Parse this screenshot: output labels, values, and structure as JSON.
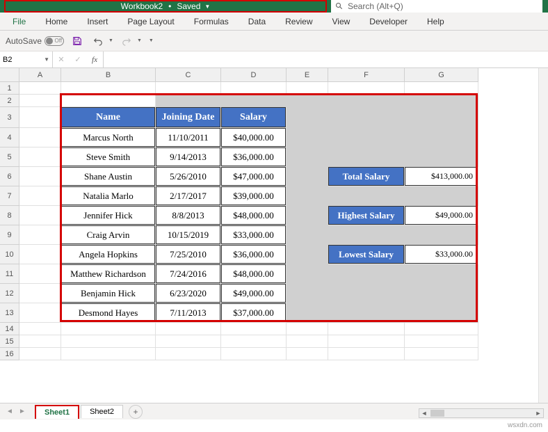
{
  "titlebar": {
    "workbook": "Workbook2",
    "status": "Saved"
  },
  "search": {
    "placeholder": "Search (Alt+Q)"
  },
  "ribbon": {
    "tabs": [
      "File",
      "Home",
      "Insert",
      "Page Layout",
      "Formulas",
      "Data",
      "Review",
      "View",
      "Developer",
      "Help"
    ]
  },
  "qat": {
    "autosave_label": "AutoSave",
    "autosave_off": "Off"
  },
  "namebox": {
    "value": "B2"
  },
  "columns": [
    {
      "letter": "A",
      "width": 60
    },
    {
      "letter": "B",
      "width": 136
    },
    {
      "letter": "C",
      "width": 94
    },
    {
      "letter": "D",
      "width": 94
    },
    {
      "letter": "E",
      "width": 60
    },
    {
      "letter": "F",
      "width": 110
    },
    {
      "letter": "G",
      "width": 106
    }
  ],
  "rows": [
    {
      "n": 1,
      "h": 18
    },
    {
      "n": 2,
      "h": 18
    },
    {
      "n": 3,
      "h": 30
    },
    {
      "n": 4,
      "h": 28
    },
    {
      "n": 5,
      "h": 28
    },
    {
      "n": 6,
      "h": 28
    },
    {
      "n": 7,
      "h": 28
    },
    {
      "n": 8,
      "h": 28
    },
    {
      "n": 9,
      "h": 28
    },
    {
      "n": 10,
      "h": 28
    },
    {
      "n": 11,
      "h": 28
    },
    {
      "n": 12,
      "h": 28
    },
    {
      "n": 13,
      "h": 28
    },
    {
      "n": 14,
      "h": 18
    },
    {
      "n": 15,
      "h": 18
    },
    {
      "n": 16,
      "h": 18
    }
  ],
  "table": {
    "headers": {
      "name": "Name",
      "date": "Joining Date",
      "salary": "Salary"
    },
    "rows": [
      {
        "name": "Marcus North",
        "date": "11/10/2011",
        "salary": "$40,000.00"
      },
      {
        "name": "Steve Smith",
        "date": "9/14/2013",
        "salary": "$36,000.00"
      },
      {
        "name": "Shane Austin",
        "date": "5/26/2010",
        "salary": "$47,000.00"
      },
      {
        "name": "Natalia Marlo",
        "date": "2/17/2017",
        "salary": "$39,000.00"
      },
      {
        "name": "Jennifer Hick",
        "date": "8/8/2013",
        "salary": "$48,000.00"
      },
      {
        "name": "Craig Arvin",
        "date": "10/15/2019",
        "salary": "$33,000.00"
      },
      {
        "name": "Angela Hopkins",
        "date": "7/25/2010",
        "salary": "$36,000.00"
      },
      {
        "name": "Matthew Richardson",
        "date": "7/24/2016",
        "salary": "$48,000.00"
      },
      {
        "name": "Benjamin Hick",
        "date": "6/23/2020",
        "salary": "$49,000.00"
      },
      {
        "name": "Desmond Hayes",
        "date": "7/11/2013",
        "salary": "$37,000.00"
      }
    ]
  },
  "summary": {
    "total": {
      "label": "Total Salary",
      "value": "$413,000.00"
    },
    "highest": {
      "label": "Highest Salary",
      "value": "$49,000.00"
    },
    "lowest": {
      "label": "Lowest Salary",
      "value": "$33,000.00"
    }
  },
  "sheets": {
    "active": "Sheet1",
    "other": "Sheet2"
  },
  "watermark": "wsxdn.com"
}
